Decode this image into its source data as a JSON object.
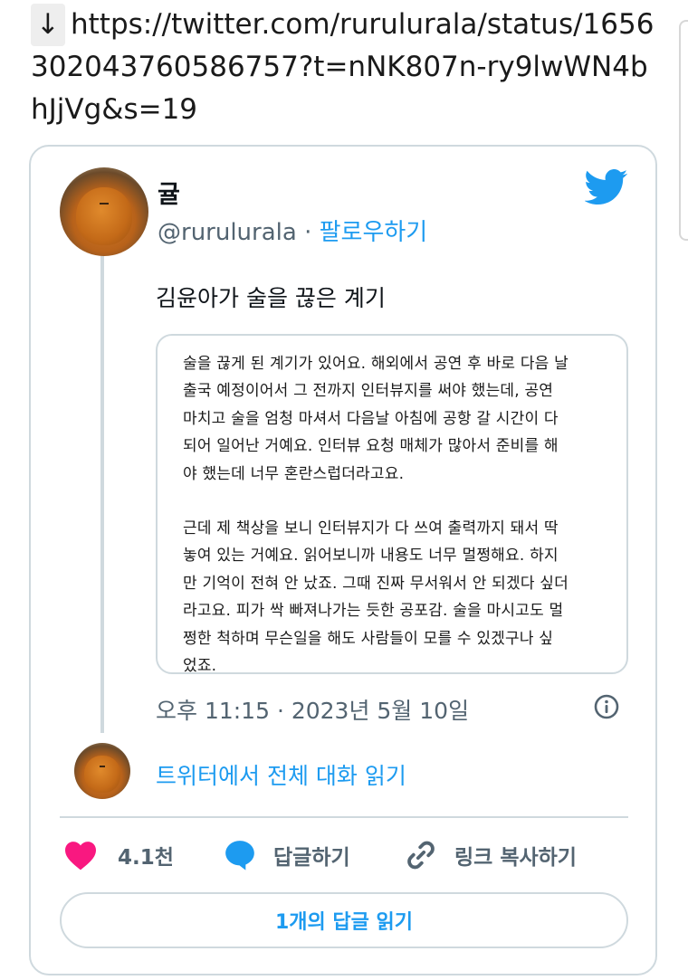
{
  "url_bar": {
    "arrow": "↓",
    "url": "https://twitter.com/rurulurala/status/1656302043760586757?t=nNK807n-ry9lwWN4bhJjVg&s=19"
  },
  "tweet": {
    "author_name": "귤",
    "handle": "@rurulurala",
    "separator": " · ",
    "follow_label": "팔로우하기",
    "text": "김윤아가 술을 끊은 계기",
    "quote_paragraph_1": "술을 끊게 된 계기가 있어요. 해외에서 공연 후 바로 다음 날\n출국 예정이어서 그 전까지 인터뷰지를 써야 했는데, 공연\n마치고 술을 엄청 마셔서 다음날 아침에 공항 갈 시간이 다\n되어 일어난 거예요. 인터뷰 요청 매체가 많아서 준비를 해\n야 했는데 너무 혼란스럽더라고요.",
    "quote_paragraph_2": "근데 제 책상을 보니 인터뷰지가 다 쓰여 출력까지 돼서 딱\n놓여 있는 거예요. 읽어보니까 내용도 너무 멀쩡해요. 하지\n만 기억이 전혀 안 났죠. 그때 진짜 무서워서 안 되겠다 싶더\n라고요. 피가 싹 빠져나가는 듯한 공포감. 술을 마시고도 멀\n쩡한 척하며 무슨일을 해도 사람들이 모를 수 있겠구나 싶\n었죠.",
    "timestamp": "오후 11:15 · 2023년 5월 10일",
    "read_full_thread": "트위터에서 전체 대화 읽기"
  },
  "actions": {
    "like_count": "4.1천",
    "reply_label": "답글하기",
    "copy_link_label": "링크 복사하기",
    "read_replies_label": "1개의 답글 읽기"
  },
  "colors": {
    "accent": "#1d9bf0",
    "like": "#f91880",
    "border": "#cfd9de",
    "muted_text": "#536471"
  },
  "icons": [
    "down-arrow-icon",
    "twitter-bird-icon",
    "info-icon",
    "heart-icon",
    "reply-bubble-icon",
    "link-icon"
  ]
}
